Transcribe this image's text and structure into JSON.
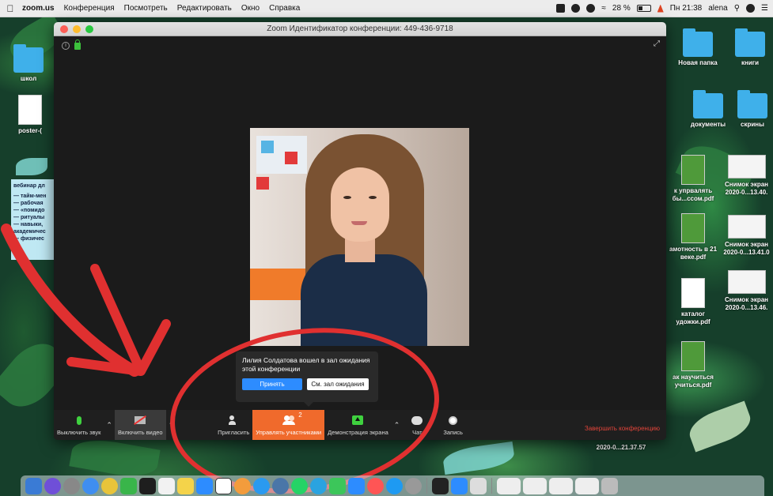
{
  "menubar": {
    "app_name": "zoom.us",
    "menu_items": [
      "Конференция",
      "Посмотреть",
      "Редактировать",
      "Окно",
      "Справка"
    ],
    "battery": "28 %",
    "clock": "Пн 21:38",
    "user": "alena"
  },
  "desktop": {
    "left_icons": [
      {
        "label": "школ"
      },
      {
        "label": "poster-("
      }
    ],
    "note_lines": [
      "вебинар дл",
      "— тайм-мен",
      "— рабочая",
      "— «помидо",
      "— ритуалы",
      "— навыки,",
      "академичес",
      "— физичес"
    ],
    "right_icons": [
      {
        "label": "Новая папка"
      },
      {
        "label": "книги"
      },
      {
        "label": "документы"
      },
      {
        "label": "скрины"
      },
      {
        "label": "к упрвалять бы...ссом.pdf"
      },
      {
        "label": "Снимок экран 2020-0...13.40."
      },
      {
        "label": "амотность в 21 веке.pdf"
      },
      {
        "label": "Снимок экран 2020-0...13.41.0"
      },
      {
        "label": "Снимок экран 2020-0...13.46."
      },
      {
        "label": "каталог удожки.pdf"
      },
      {
        "label": "ак научиться учиться.pdf"
      },
      {
        "label": "2020-0...21.37.57"
      }
    ]
  },
  "zoom": {
    "window_title": "Zoom Идентификатор конференции: 449-436-9718",
    "popup": {
      "message": "Лилия Солдатова вошел в зал ожидания этой конференции",
      "admit_label": "Принять",
      "see_waiting_room_label": "См. зал ожидания"
    },
    "toolbar": {
      "mute_label": "Выключить звук",
      "video_label": "Включить видео",
      "invite_label": "Пригласить",
      "participants_label": "Управлять участниками",
      "participants_count": "2",
      "share_label": "Демонстрация экрана",
      "chat_label": "Чат",
      "record_label": "Запись",
      "end_label": "Завершить конференцию"
    }
  },
  "colors": {
    "accent_orange": "#f06a2c",
    "admit_blue": "#2d8cff",
    "annotation_red": "#e03030",
    "end_red": "#e0443a"
  }
}
